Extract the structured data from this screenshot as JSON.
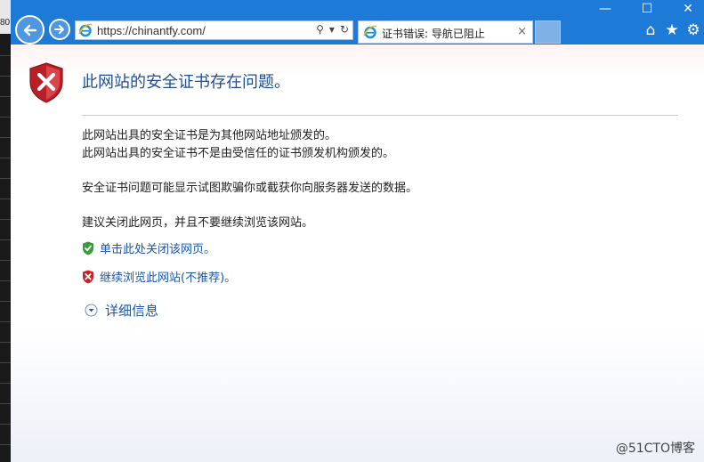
{
  "background_window": {
    "number_fragment": "80"
  },
  "browser": {
    "url": "https://chinantfy.com/",
    "tab_title": "证书错误: 导航已阻止",
    "tab_close": "×",
    "window_controls": {
      "minimize": "—",
      "maximize": "☐",
      "close": "✕"
    },
    "toolbar": {
      "home": "⌂",
      "favorites": "★",
      "settings": "⚙"
    },
    "address_tools": {
      "search": "⚲",
      "dropdown": "▾",
      "refresh": "↻"
    }
  },
  "page": {
    "heading": "此网站的安全证书存在问题。",
    "paragraphs": [
      "此网站出具的安全证书是为其他网站地址颁发的。",
      "此网站出具的安全证书不是由受信任的证书颁发机构颁发的。",
      "安全证书问题可能显示试图欺骗你或截获你向服务器发送的数据。",
      "建议关闭此网页，并且不要继续浏览该网站。"
    ],
    "close_link": "单击此处关闭该网页。",
    "continue_link": "继续浏览此网站(不推荐)。",
    "details": "详细信息"
  },
  "watermark": "@51CTO博客",
  "colors": {
    "chrome": "#1e7ad7",
    "heading": "#1f4e99",
    "link": "#1d57a8",
    "shield_red": "#c8232c",
    "shield_green": "#3c9a3c"
  }
}
